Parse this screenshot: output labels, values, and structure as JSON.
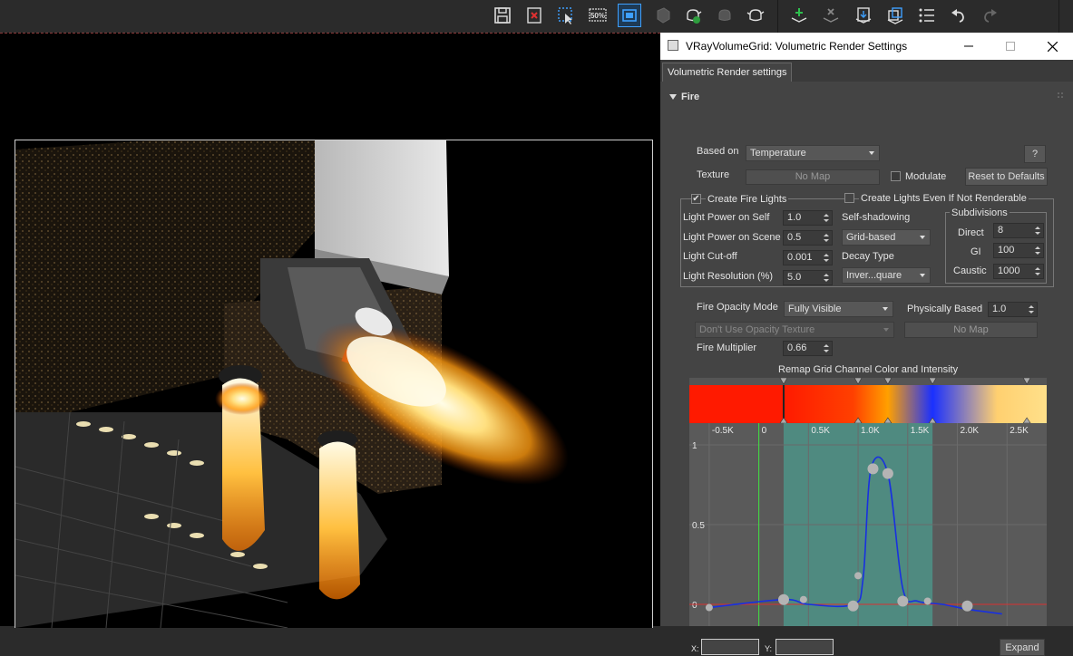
{
  "toolbar": {
    "icons": [
      "save-icon",
      "delete-icon",
      "select-region-icon",
      "percent-icon",
      "frame-icon",
      "render-disabled-icon",
      "teapot-render-icon",
      "teapot-disabled-icon",
      "teapot-icon",
      "add-layer-icon",
      "remove-layer-icon",
      "export-icon",
      "duplicate-icon",
      "list-icon",
      "undo-icon",
      "redo-icon"
    ],
    "percent_label": "50%"
  },
  "dialog": {
    "title": "VRayVolumeGrid: Volumetric Render Settings",
    "tab": "Volumetric Render settings",
    "section": "Fire",
    "based_on_label": "Based on",
    "based_on_value": "Temperature",
    "help_label": "?",
    "texture_label": "Texture",
    "texture_button": "No Map",
    "modulate_label": "Modulate",
    "reset_button": "Reset to Defaults",
    "create_fire_lights_label": "Create Fire Lights",
    "create_fire_lights_checked": true,
    "create_lights_not_renderable_label": "Create Lights Even If Not Renderable",
    "light_power_self_label": "Light Power on Self",
    "light_power_self_value": "1.0",
    "light_power_scene_label": "Light Power on Scene",
    "light_power_scene_value": "0.5",
    "light_cutoff_label": "Light Cut-off",
    "light_cutoff_value": "0.001",
    "light_resolution_label": "Light Resolution (%)",
    "light_resolution_value": "5.0",
    "self_shadowing_label": "Self-shadowing",
    "self_shadowing_value": "Grid-based",
    "decay_type_label": "Decay Type",
    "decay_type_value": "Inver...quare",
    "subdivisions_label": "Subdivisions",
    "direct_label": "Direct",
    "direct_value": "8",
    "gi_label": "GI",
    "gi_value": "100",
    "caustic_label": "Caustic",
    "caustic_value": "1000",
    "fire_opacity_mode_label": "Fire Opacity Mode",
    "fire_opacity_mode_value": "Fully Visible",
    "physically_based_label": "Physically Based",
    "physically_based_value": "1.0",
    "opacity_texture_value": "Don't Use Opacity Texture",
    "opacity_map_button": "No Map",
    "fire_multiplier_label": "Fire Multiplier",
    "fire_multiplier_value": "0.66",
    "remap_title": "Remap Grid Channel Color and Intensity",
    "x_label": "X:",
    "y_label": "Y:",
    "expand_button": "Expand"
  },
  "chart_data": {
    "type": "line",
    "title": "Remap Grid Channel Color and Intensity",
    "x_ticks": [
      "-0.5K",
      "0",
      "0.5K",
      "1.0K",
      "1.5K",
      "2.0K",
      "2.5K"
    ],
    "y_ticks": [
      "1",
      "0.5",
      "0"
    ],
    "xlim": [
      -0.7,
      2.9
    ],
    "ylim": [
      0,
      1
    ],
    "series": [
      {
        "x": [
          -0.5,
          0.25,
          0.5,
          0.95,
          1.05,
          1.13,
          1.3,
          1.45,
          1.6,
          1.85,
          2.1,
          2.45
        ],
        "y": [
          -0.02,
          0.03,
          0.0,
          0.0,
          0.16,
          0.85,
          0.82,
          0.1,
          0.02,
          0.0,
          -0.03,
          -0.06
        ]
      }
    ],
    "control_points_x": [
      -0.5,
      0.25,
      0.45,
      0.95,
      1.0,
      1.15,
      1.3,
      1.45,
      1.7,
      2.1
    ],
    "control_points_y": [
      -0.02,
      0.03,
      0.03,
      -0.01,
      0.18,
      0.85,
      0.82,
      0.02,
      0.02,
      -0.01
    ],
    "highlight_range": [
      0.25,
      1.75
    ],
    "gradient_stops": [
      {
        "pos": -0.7,
        "color": "#ff1a00"
      },
      {
        "pos": 0.25,
        "color": "#ff1a00"
      },
      {
        "pos": 0.95,
        "color": "#ff4000"
      },
      {
        "pos": 1.3,
        "color": "#ffa000"
      },
      {
        "pos": 1.75,
        "color": "#1a30ff"
      },
      {
        "pos": 2.4,
        "color": "#ffd070"
      },
      {
        "pos": 2.9,
        "color": "#ffe08a"
      }
    ]
  }
}
